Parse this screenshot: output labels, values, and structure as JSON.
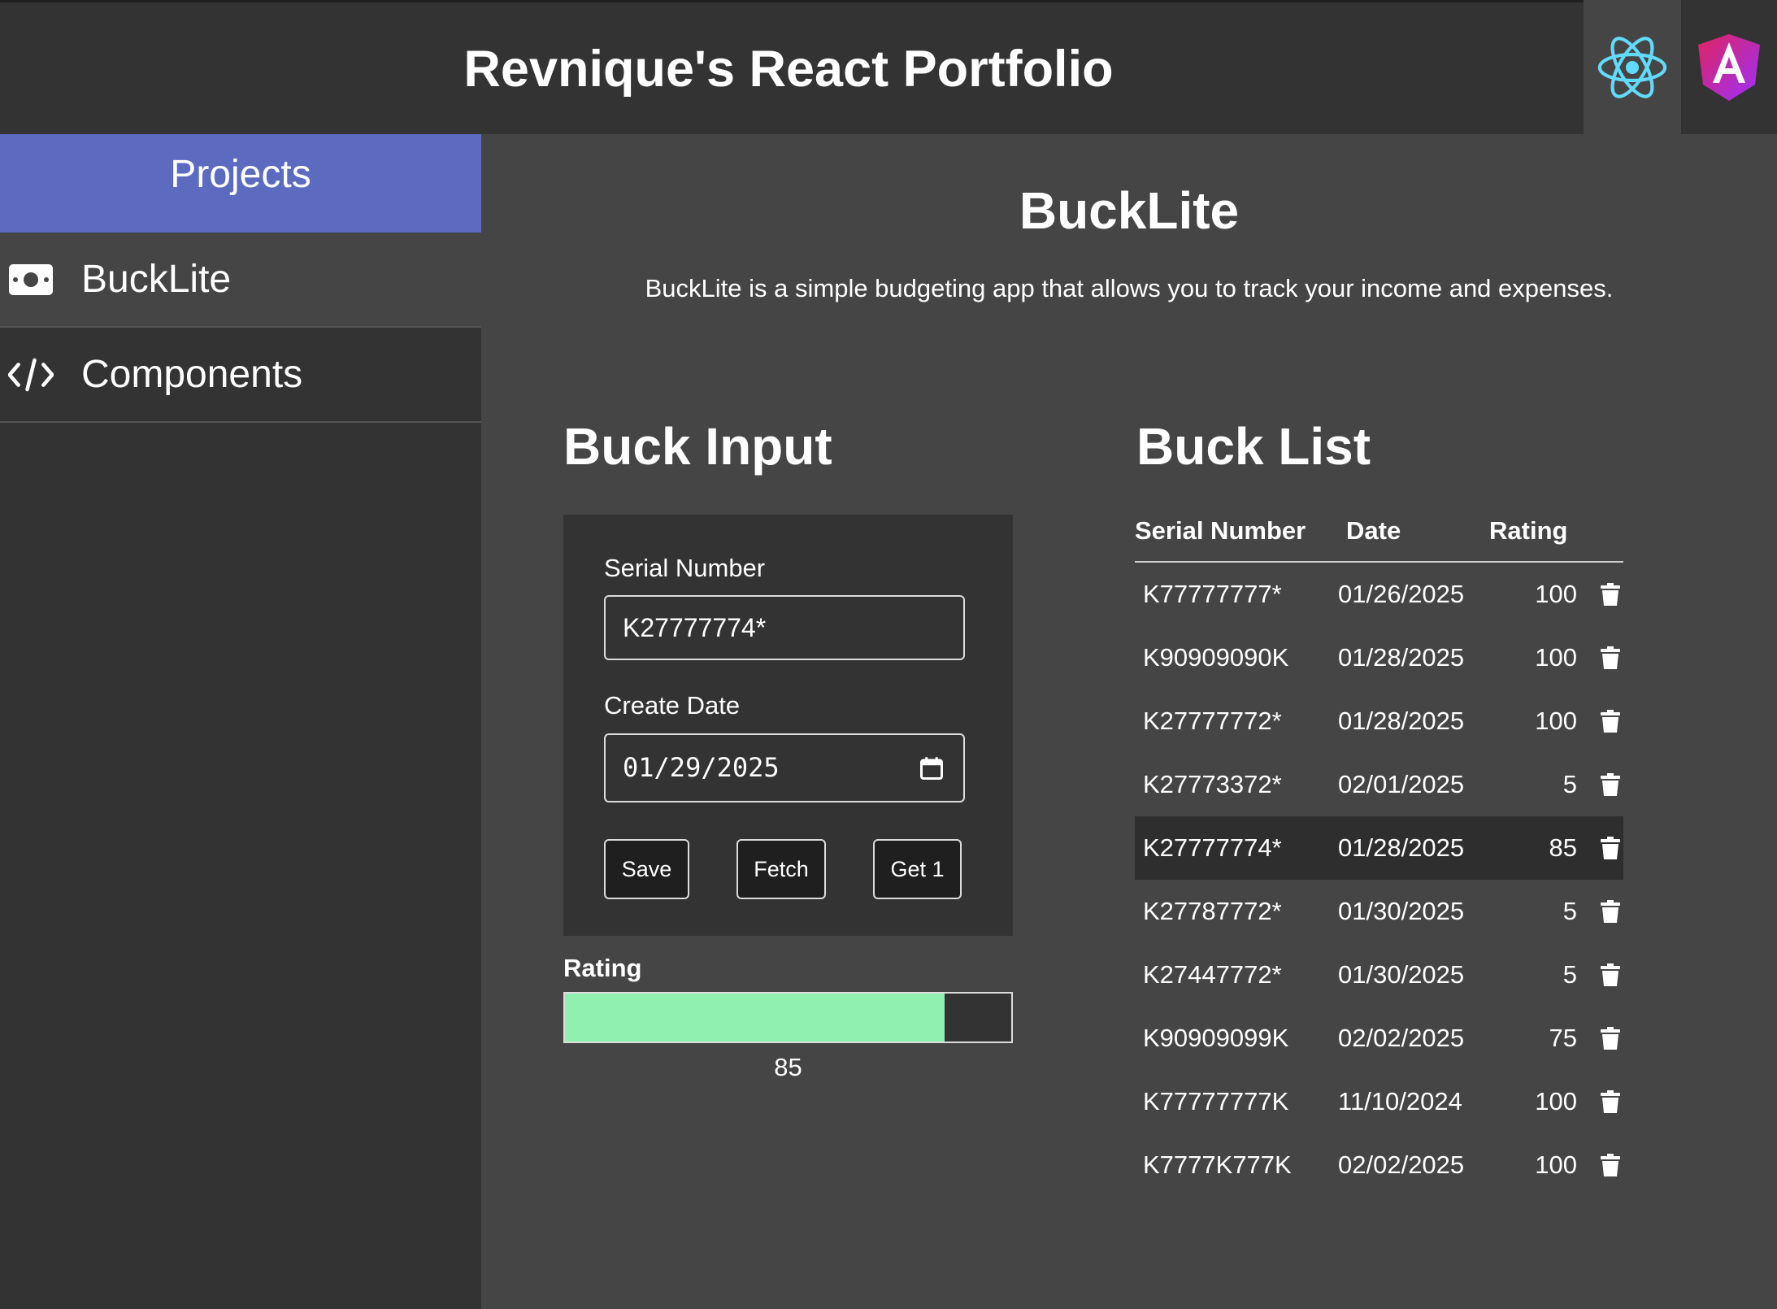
{
  "header": {
    "title": "Revnique's React Portfolio",
    "react_icon": "react-logo-icon",
    "angular_icon": "angular-logo-icon"
  },
  "sidebar": {
    "header": "Projects",
    "items": [
      {
        "label": "BuckLite",
        "icon": "money-bill-icon",
        "active": true
      },
      {
        "label": "Components",
        "icon": "code-icon",
        "active": false
      }
    ]
  },
  "project": {
    "title": "BuckLite",
    "description": "BuckLite is a simple budgeting app that allows you to track your income and expenses."
  },
  "buck_input": {
    "title": "Buck Input",
    "serial_label": "Serial Number",
    "serial_value": "K27777774*",
    "date_label": "Create Date",
    "date_value": "01/29/2025",
    "buttons": {
      "save": "Save",
      "fetch": "Fetch",
      "get_one": "Get 1"
    },
    "rating_label": "Rating",
    "rating_value": "85",
    "rating_percent": 85
  },
  "buck_list": {
    "title": "Buck List",
    "columns": {
      "serial": "Serial Number",
      "date": "Date",
      "rating": "Rating"
    },
    "rows": [
      {
        "serial": "K77777777*",
        "date": "01/26/2025",
        "rating": "100"
      },
      {
        "serial": "K90909090K",
        "date": "01/28/2025",
        "rating": "100"
      },
      {
        "serial": "K27777772*",
        "date": "01/28/2025",
        "rating": "100"
      },
      {
        "serial": "K27773372*",
        "date": "02/01/2025",
        "rating": "5"
      },
      {
        "serial": "K27777774*",
        "date": "01/28/2025",
        "rating": "85",
        "selected": true
      },
      {
        "serial": "K27787772*",
        "date": "01/30/2025",
        "rating": "5"
      },
      {
        "serial": "K27447772*",
        "date": "01/30/2025",
        "rating": "5"
      },
      {
        "serial": "K90909099K",
        "date": "02/02/2025",
        "rating": "75"
      },
      {
        "serial": "K77777777K",
        "date": "11/10/2024",
        "rating": "100"
      },
      {
        "serial": "K7777K777K",
        "date": "02/02/2025",
        "rating": "100"
      }
    ]
  },
  "colors": {
    "sidebar_header": "#5c6bc0",
    "rating_fill": "#90f0b0",
    "react_blue": "#61dafb",
    "angular_pink": "#e0245e"
  }
}
